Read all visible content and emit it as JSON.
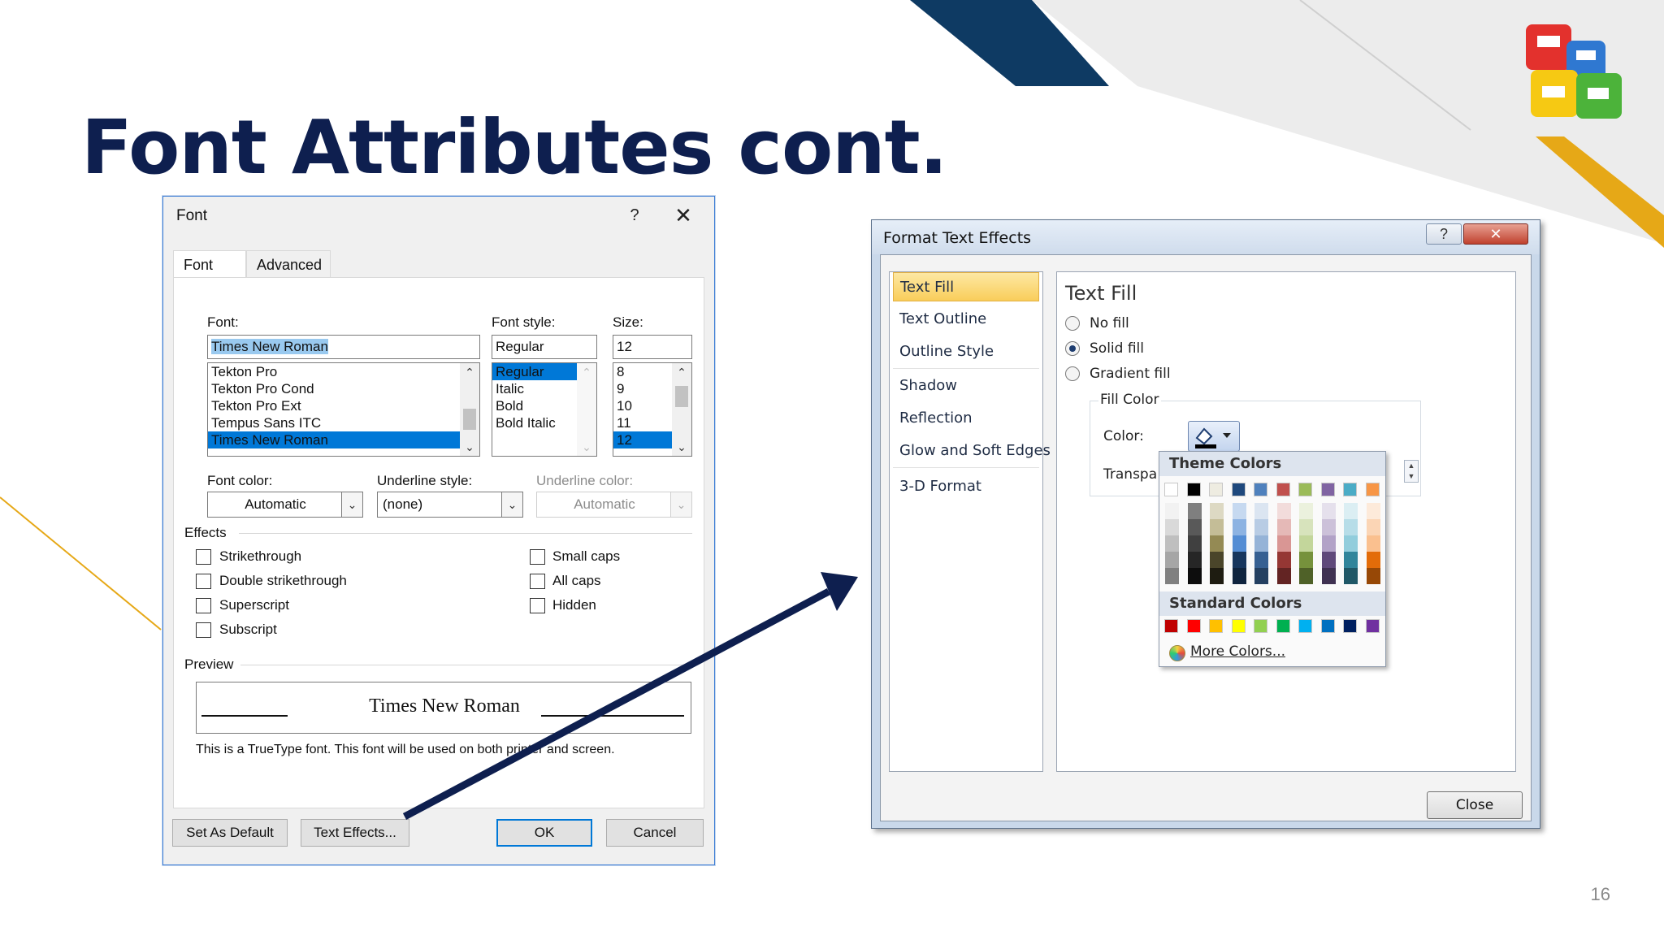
{
  "slide": {
    "title": "Font Attributes cont.",
    "page_number": "16",
    "logo": "microsoft-office-logo",
    "colors": {
      "title": "#0e1f4f",
      "accent_navy": "#0e3a63",
      "accent_gold": "#e6a817",
      "arrow": "#0e1f4f"
    }
  },
  "font_dialog": {
    "title": "Font",
    "help_label": "?",
    "close_label": "✕",
    "tabs": [
      {
        "label": "Font"
      },
      {
        "label": "Advanced"
      }
    ],
    "font_label": "Font:",
    "font_value": "Times New Roman",
    "font_list": [
      "Tekton Pro",
      "Tekton Pro Cond",
      "Tekton Pro Ext",
      "Tempus Sans ITC",
      "Times New Roman"
    ],
    "style_label": "Font style:",
    "style_value": "Regular",
    "style_list": [
      "Regular",
      "Italic",
      "Bold",
      "Bold Italic"
    ],
    "size_label": "Size:",
    "size_value": "12",
    "size_list": [
      "8",
      "9",
      "10",
      "11",
      "12"
    ],
    "font_color_label": "Font color:",
    "font_color_value": "Automatic",
    "underline_style_label": "Underline style:",
    "underline_style_value": "(none)",
    "underline_color_label": "Underline color:",
    "underline_color_value": "Automatic",
    "effects_label": "Effects",
    "effects_left": [
      "Strikethrough",
      "Double strikethrough",
      "Superscript",
      "Subscript"
    ],
    "effects_right": [
      "Small caps",
      "All caps",
      "Hidden"
    ],
    "preview_label": "Preview",
    "preview_text": "Times New Roman",
    "preview_note": "This is a TrueType font. This font will be used on both printer and screen.",
    "buttons": {
      "set_default": "Set As Default",
      "text_effects": "Text Effects...",
      "ok": "OK",
      "cancel": "Cancel"
    }
  },
  "effects_dialog": {
    "title": "Format Text Effects",
    "help_label": "?",
    "close_label": "✕",
    "nav": [
      "Text Fill",
      "Text Outline",
      "Outline Style",
      "Shadow",
      "Reflection",
      "Glow and Soft Edges",
      "3-D Format"
    ],
    "panel_heading": "Text Fill",
    "fill_options": [
      "No fill",
      "Solid fill",
      "Gradient fill"
    ],
    "selected_fill": "Solid fill",
    "fill_color_group": "Fill Color",
    "color_label": "Color:",
    "transparency_label": "Transpa",
    "close_button": "Close"
  },
  "color_popup": {
    "theme_heading": "Theme Colors",
    "standard_heading": "Standard Colors",
    "more_colors": "More Colors...",
    "theme_colors": [
      "#ffffff",
      "#000000",
      "#eeece1",
      "#1f497d",
      "#4f81bd",
      "#c0504d",
      "#9bbb59",
      "#8064a2",
      "#4bacc6",
      "#f79646"
    ],
    "theme_shades": [
      [
        "#f2f2f2",
        "#d9d9d9",
        "#bfbfbf",
        "#a6a6a6",
        "#808080"
      ],
      [
        "#7f7f7f",
        "#595959",
        "#404040",
        "#262626",
        "#0d0d0d"
      ],
      [
        "#ddd9c3",
        "#c4bd97",
        "#948a54",
        "#4a452a",
        "#1e1c11"
      ],
      [
        "#c6d9f0",
        "#8db3e2",
        "#548dd4",
        "#17365d",
        "#0f243e"
      ],
      [
        "#dbe5f1",
        "#b8cce4",
        "#95b3d7",
        "#366092",
        "#244061"
      ],
      [
        "#f2dcdb",
        "#e5b9b7",
        "#d99694",
        "#953734",
        "#632423"
      ],
      [
        "#ebf1dd",
        "#d7e3bc",
        "#c3d69b",
        "#76923c",
        "#4f6128"
      ],
      [
        "#e5e0ec",
        "#ccc1d9",
        "#b2a2c7",
        "#5f497a",
        "#3f3151"
      ],
      [
        "#dbeef3",
        "#b7dde8",
        "#92cddc",
        "#31859b",
        "#205867"
      ],
      [
        "#fdeada",
        "#fbd5b5",
        "#fac08f",
        "#e36c09",
        "#974806"
      ]
    ],
    "standard_colors": [
      "#c00000",
      "#ff0000",
      "#ffc000",
      "#ffff00",
      "#92d050",
      "#00b050",
      "#00b0f0",
      "#0070c0",
      "#002060",
      "#7030a0"
    ]
  }
}
